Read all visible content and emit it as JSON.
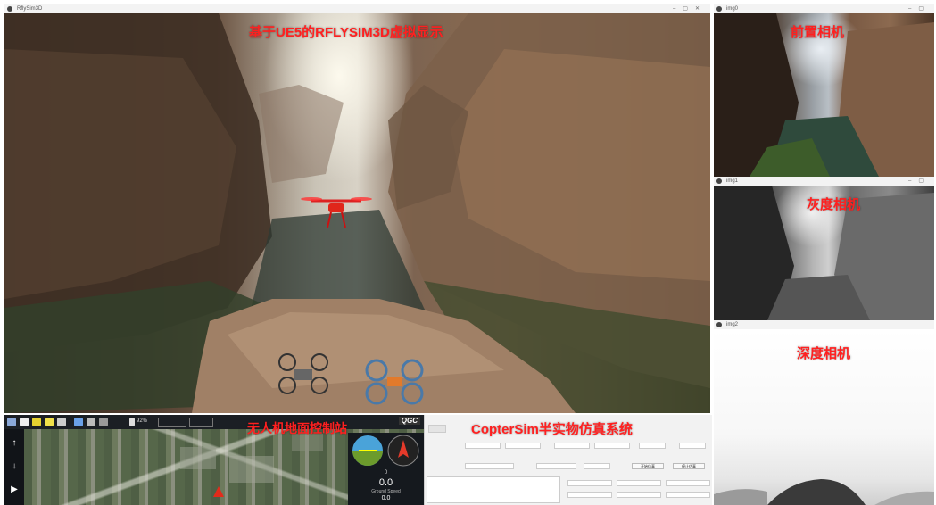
{
  "main_window": {
    "title": "RflySim3D",
    "overlay_title": "基于UE5的RFLYSIM3D虚拟显示"
  },
  "cameras": [
    {
      "window_title": "img0",
      "label": "前置相机"
    },
    {
      "window_title": "img1",
      "label": "灰度相机"
    },
    {
      "window_title": "img2",
      "label": "深度相机"
    }
  ],
  "qgc": {
    "overlay_title": "无人机地面控制站",
    "battery": "92%",
    "logo": "QGC",
    "instrument": {
      "readout_1": "0",
      "readout_2": "0.0",
      "readout_3": "Ground Speed",
      "readout_4": "0.0"
    },
    "left_tools": [
      "↑",
      "↓",
      "▶"
    ]
  },
  "coptersim": {
    "overlay_title": "CopterSim半实物仿真系统",
    "start_button": "开始仿真",
    "stop_button": "停止仿真"
  },
  "colors": {
    "overlay_red": "#ff2020",
    "qgc_toolbar": "#1b1f24"
  }
}
